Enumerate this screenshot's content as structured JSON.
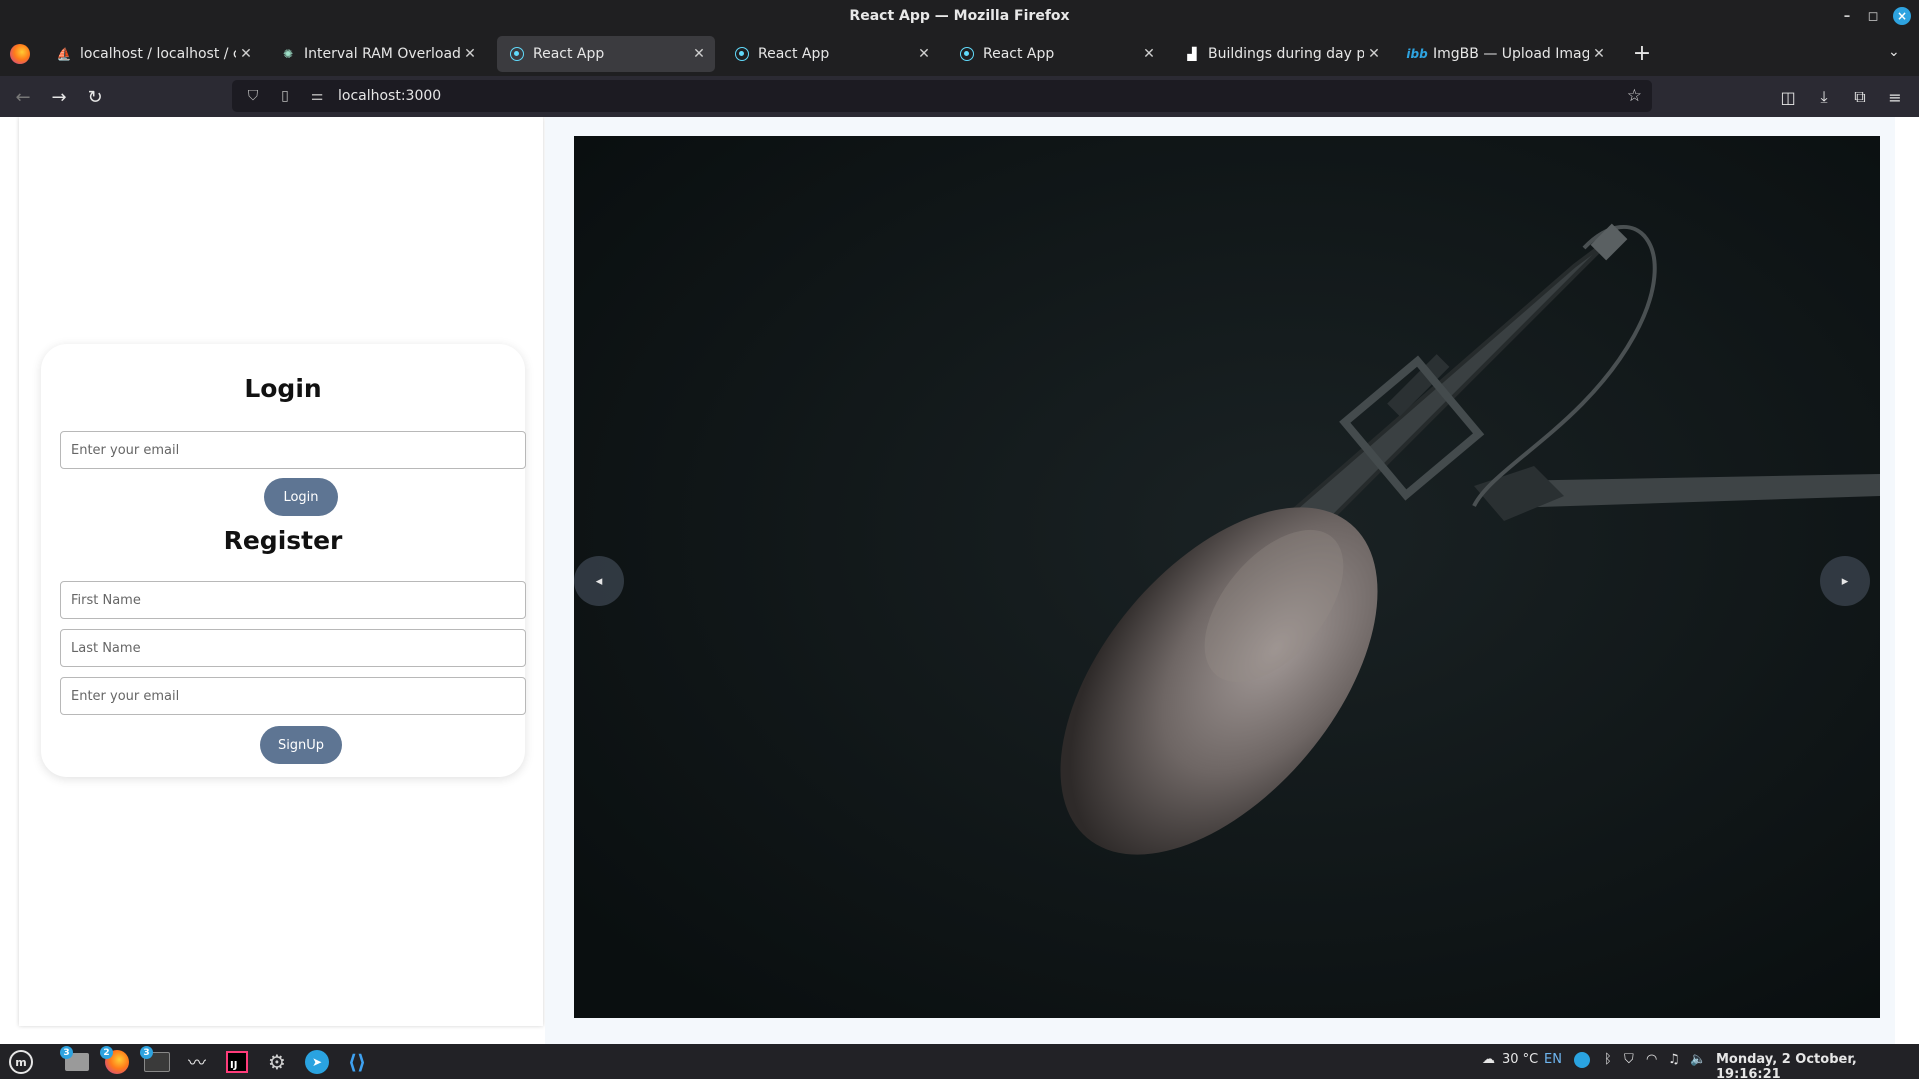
{
  "window": {
    "title": "React App — Mozilla Firefox"
  },
  "tabs": [
    {
      "title": "localhost / localhost / chat/",
      "icon": "phpmyadmin-icon",
      "active": false
    },
    {
      "title": "Interval RAM Overload Fix",
      "icon": "chatgpt-icon",
      "active": false
    },
    {
      "title": "React App",
      "icon": "react-icon",
      "active": true
    },
    {
      "title": "React App",
      "icon": "react-icon",
      "active": false
    },
    {
      "title": "React App",
      "icon": "react-icon",
      "active": false
    },
    {
      "title": "Buildings during day photo",
      "icon": "unsplash-icon",
      "active": false
    },
    {
      "title": "ImgBB — Upload Image — I",
      "icon": "imgbb-icon",
      "active": false
    }
  ],
  "toolbar": {
    "new_tab": "+",
    "tab_list": "⌄"
  },
  "urlbar": {
    "url": "localhost:3000"
  },
  "login": {
    "heading": "Login",
    "email_placeholder": "Enter your email",
    "button": "Login"
  },
  "register": {
    "heading": "Register",
    "first_name_placeholder": "First Name",
    "last_name_placeholder": "Last Name",
    "email_placeholder": "Enter your email",
    "button": "SignUp"
  },
  "carousel": {
    "image_subject": "microphone with furry windscreen on boom arm",
    "prev": "◂",
    "next": "▸"
  },
  "taskbar": {
    "apps": [
      {
        "icon": "files-icon",
        "badge": "3"
      },
      {
        "icon": "firefox-icon",
        "badge": "2"
      },
      {
        "icon": "terminal-icon",
        "badge": "3"
      },
      {
        "icon": "system-monitor-icon",
        "badge": ""
      },
      {
        "icon": "intellij-icon",
        "badge": ""
      },
      {
        "icon": "settings-icon",
        "badge": ""
      },
      {
        "icon": "telegram-icon",
        "badge": ""
      },
      {
        "icon": "vscode-icon",
        "badge": ""
      }
    ],
    "weather": "30 °C",
    "keyboard_layout": "EN",
    "datetime": "Monday, 2 October, 19:16:21"
  },
  "colors": {
    "accent_button": "#5e7593",
    "chrome_dark": "#1f1f21",
    "carousel_bg": "#0e1416"
  }
}
